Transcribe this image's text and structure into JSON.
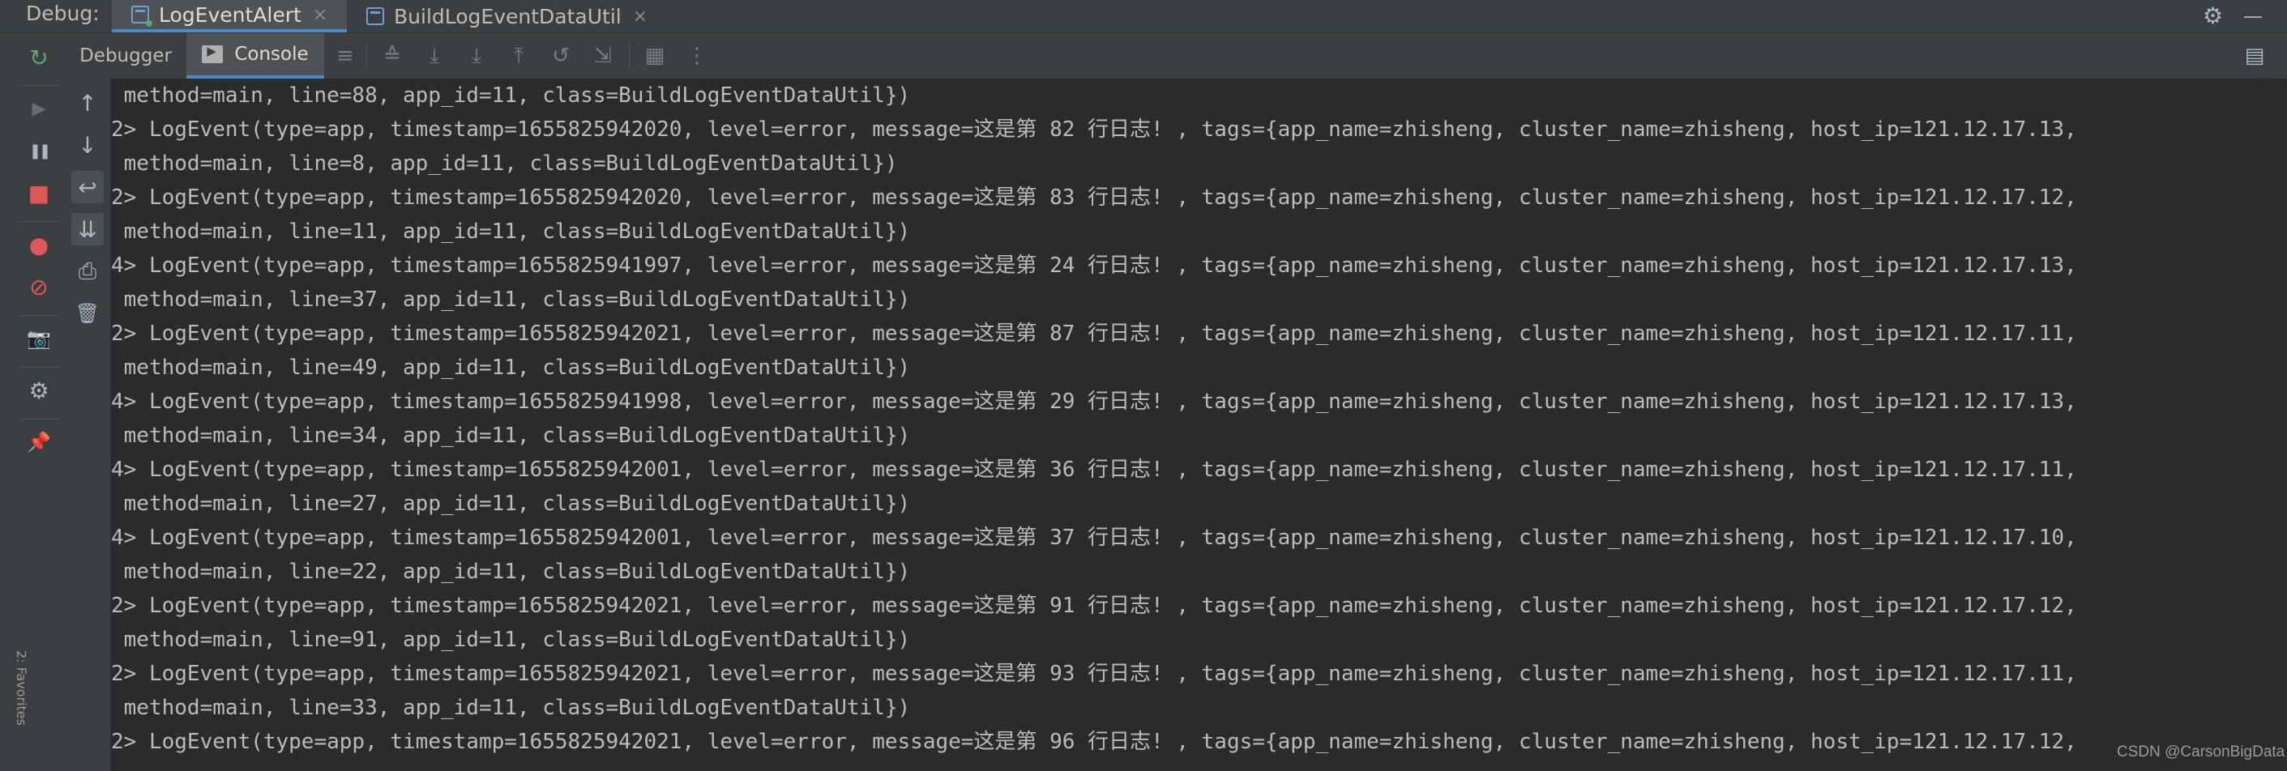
{
  "topbar": {
    "debug_label": "Debug:",
    "tabs": [
      {
        "label": "LogEventAlert",
        "close": "×"
      },
      {
        "label": "BuildLogEventDataUtil",
        "close": "×"
      }
    ],
    "settings_icon": "⚙",
    "minimize_icon": "—"
  },
  "debugger": {
    "tabs": [
      {
        "label": "Debugger"
      },
      {
        "label": "Console"
      }
    ]
  },
  "icons": {
    "rerun": "↻",
    "resume": "▶",
    "pause": "❚❚",
    "stop": "■",
    "view_breakpoints": "●",
    "mute_breakpoints": "⊘",
    "snapshot": "📷",
    "settings": "⚙",
    "pin": "📌",
    "up": "↑",
    "down": "↓",
    "soft_wrap": "↩",
    "scroll_end": "⇊",
    "print": "⎙",
    "clear": "🗑",
    "layout": "▤"
  },
  "colors": {
    "background": "#2b2b2b",
    "panel": "#3c3f41",
    "accent": "#4a88c7",
    "text": "#bbbbbb",
    "rerun": "#59a869",
    "stop": "#e05555"
  },
  "console": {
    "lines": [
      " method=main, line=88, app_id=11, class=BuildLogEventDataUtil})",
      "2> LogEvent(type=app, timestamp=1655825942020, level=error, message=这是第 82 行日志! , tags={app_name=zhisheng, cluster_name=zhisheng, host_ip=121.12.17.13,",
      " method=main, line=8, app_id=11, class=BuildLogEventDataUtil})",
      "2> LogEvent(type=app, timestamp=1655825942020, level=error, message=这是第 83 行日志! , tags={app_name=zhisheng, cluster_name=zhisheng, host_ip=121.12.17.12,",
      " method=main, line=11, app_id=11, class=BuildLogEventDataUtil})",
      "4> LogEvent(type=app, timestamp=1655825941997, level=error, message=这是第 24 行日志! , tags={app_name=zhisheng, cluster_name=zhisheng, host_ip=121.12.17.13,",
      " method=main, line=37, app_id=11, class=BuildLogEventDataUtil})",
      "2> LogEvent(type=app, timestamp=1655825942021, level=error, message=这是第 87 行日志! , tags={app_name=zhisheng, cluster_name=zhisheng, host_ip=121.12.17.11,",
      " method=main, line=49, app_id=11, class=BuildLogEventDataUtil})",
      "4> LogEvent(type=app, timestamp=1655825941998, level=error, message=这是第 29 行日志! , tags={app_name=zhisheng, cluster_name=zhisheng, host_ip=121.12.17.13,",
      " method=main, line=34, app_id=11, class=BuildLogEventDataUtil})",
      "4> LogEvent(type=app, timestamp=1655825942001, level=error, message=这是第 36 行日志! , tags={app_name=zhisheng, cluster_name=zhisheng, host_ip=121.12.17.11,",
      " method=main, line=27, app_id=11, class=BuildLogEventDataUtil})",
      "4> LogEvent(type=app, timestamp=1655825942001, level=error, message=这是第 37 行日志! , tags={app_name=zhisheng, cluster_name=zhisheng, host_ip=121.12.17.10,",
      " method=main, line=22, app_id=11, class=BuildLogEventDataUtil})",
      "2> LogEvent(type=app, timestamp=1655825942021, level=error, message=这是第 91 行日志! , tags={app_name=zhisheng, cluster_name=zhisheng, host_ip=121.12.17.12,",
      " method=main, line=91, app_id=11, class=BuildLogEventDataUtil})",
      "2> LogEvent(type=app, timestamp=1655825942021, level=error, message=这是第 93 行日志! , tags={app_name=zhisheng, cluster_name=zhisheng, host_ip=121.12.17.11,",
      " method=main, line=33, app_id=11, class=BuildLogEventDataUtil})",
      "2> LogEvent(type=app, timestamp=1655825942021, level=error, message=这是第 96 行日志! , tags={app_name=zhisheng, cluster_name=zhisheng, host_ip=121.12.17.12,"
    ]
  },
  "watermark": "CSDN @CarsonBigData",
  "favorites_label": "2: Favorites"
}
